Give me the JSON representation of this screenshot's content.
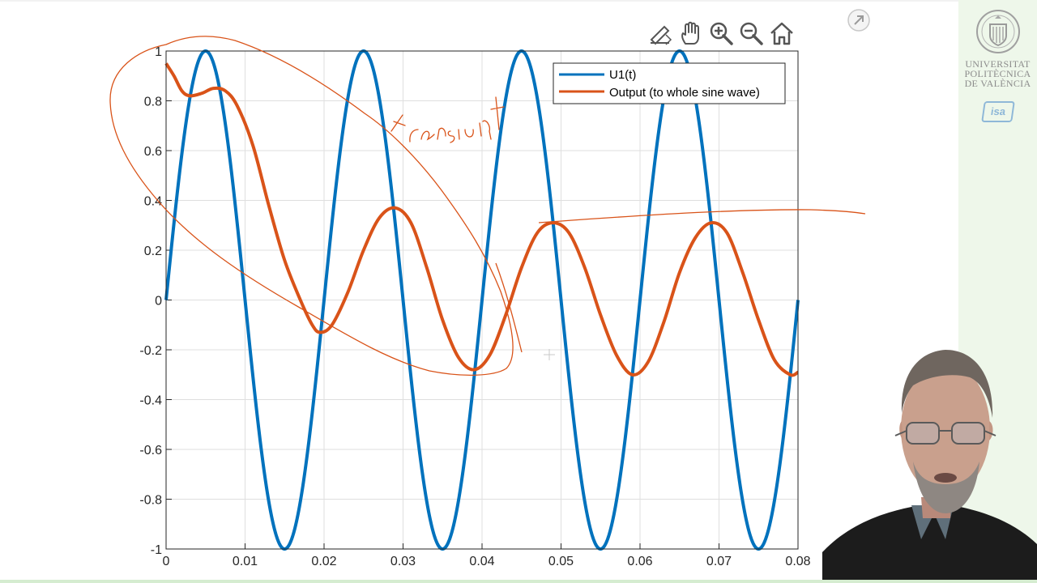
{
  "chart_data": {
    "type": "line",
    "title": "",
    "xlabel": "",
    "ylabel": "",
    "xlim": [
      0,
      0.08
    ],
    "ylim": [
      -1,
      1
    ],
    "x_ticks": [
      "0",
      "0.01",
      "0.02",
      "0.03",
      "0.04",
      "0.05",
      "0.06",
      "0.07",
      "0.08"
    ],
    "y_ticks": [
      "1",
      "0.8",
      "0.6",
      "0.4",
      "0.2",
      "0",
      "-0.2",
      "-0.4",
      "-0.6",
      "-0.8",
      "-1"
    ],
    "grid": true,
    "legend_position": "top-right",
    "series": [
      {
        "name": "U1(t)",
        "color": "#0072bd",
        "description": "sine wave, amplitude 1, period 0.02",
        "amplitude": 1,
        "period": 0.02,
        "peaks": [
          [
            0.005,
            1
          ],
          [
            0.025,
            1
          ],
          [
            0.045,
            1
          ],
          [
            0.065,
            1
          ]
        ],
        "troughs": [
          [
            0.015,
            -1
          ],
          [
            0.035,
            -1
          ],
          [
            0.055,
            -1
          ],
          [
            0.075,
            -1
          ]
        ]
      },
      {
        "name": "Output (to whole sine wave)",
        "color": "#d95319",
        "points": [
          [
            0,
            0.95
          ],
          [
            0.001,
            0.9
          ],
          [
            0.002,
            0.84
          ],
          [
            0.003,
            0.82
          ],
          [
            0.0045,
            0.83
          ],
          [
            0.006,
            0.85
          ],
          [
            0.0075,
            0.84
          ],
          [
            0.009,
            0.78
          ],
          [
            0.011,
            0.62
          ],
          [
            0.013,
            0.38
          ],
          [
            0.015,
            0.16
          ],
          [
            0.017,
            0.0
          ],
          [
            0.0185,
            -0.1
          ],
          [
            0.0195,
            -0.13
          ],
          [
            0.021,
            -0.1
          ],
          [
            0.023,
            0.03
          ],
          [
            0.025,
            0.2
          ],
          [
            0.027,
            0.33
          ],
          [
            0.029,
            0.37
          ],
          [
            0.031,
            0.31
          ],
          [
            0.033,
            0.13
          ],
          [
            0.035,
            -0.08
          ],
          [
            0.037,
            -0.23
          ],
          [
            0.039,
            -0.28
          ],
          [
            0.041,
            -0.22
          ],
          [
            0.043,
            -0.06
          ],
          [
            0.045,
            0.13
          ],
          [
            0.047,
            0.27
          ],
          [
            0.049,
            0.31
          ],
          [
            0.051,
            0.27
          ],
          [
            0.053,
            0.13
          ],
          [
            0.055,
            -0.06
          ],
          [
            0.057,
            -0.22
          ],
          [
            0.059,
            -0.3
          ],
          [
            0.061,
            -0.25
          ],
          [
            0.063,
            -0.09
          ],
          [
            0.065,
            0.11
          ],
          [
            0.067,
            0.25
          ],
          [
            0.069,
            0.31
          ],
          [
            0.071,
            0.27
          ],
          [
            0.073,
            0.11
          ],
          [
            0.075,
            -0.08
          ],
          [
            0.077,
            -0.24
          ],
          [
            0.079,
            -0.3
          ],
          [
            0.08,
            -0.29
          ]
        ]
      }
    ],
    "annotations": [
      {
        "text": "transient",
        "style": "handwritten",
        "color": "#d95319"
      }
    ]
  },
  "toolbar": {
    "icons": [
      "pen-arrow-icon",
      "hand-pan-icon",
      "zoom-in-icon",
      "zoom-out-icon",
      "home-icon"
    ],
    "popout_icon": "popout-arrow-icon"
  },
  "branding": {
    "university_lines": [
      "UNIVERSITAT",
      "POLITÈCNICA",
      "DE VALÈNCIA"
    ],
    "badge": "isa"
  },
  "colors": {
    "axis": "#262626",
    "grid": "#dfdfdf",
    "side_panel": "#eef7ea"
  }
}
